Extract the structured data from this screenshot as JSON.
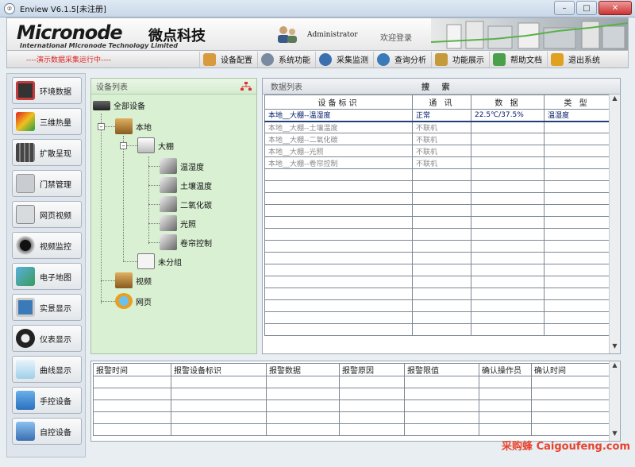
{
  "window": {
    "title": "Enview V6.1.5[未注册]",
    "icon_text": "②"
  },
  "header": {
    "logo": "Micronode",
    "logo_cn": "微点科技",
    "subtitle": "International Micronode Technology Limited",
    "username": "Administrator",
    "welcome": "欢迎登录"
  },
  "toolbar": {
    "running_text": "----演示数据采集运行中----",
    "items": [
      {
        "label": "设备配置",
        "icon": "device-config-icon",
        "color": "#d89a3a"
      },
      {
        "label": "系统功能",
        "icon": "gear-icon",
        "color": "#7a8aa0"
      },
      {
        "label": "采集监测",
        "icon": "search-icon",
        "color": "#3a6fb0"
      },
      {
        "label": "查询分析",
        "icon": "query-icon",
        "color": "#3a7ab8"
      },
      {
        "label": "功能展示",
        "icon": "display-icon",
        "color": "#c59a3a"
      },
      {
        "label": "帮助文档",
        "icon": "help-book-icon",
        "color": "#4aa04a"
      },
      {
        "label": "退出系统",
        "icon": "exit-icon",
        "color": "#e0a020"
      }
    ]
  },
  "sidebar": {
    "items": [
      {
        "label": "环境数据",
        "icon": "thermometer-icon",
        "color": "#c43c3c"
      },
      {
        "label": "三维热量",
        "icon": "heatmap-icon",
        "color": "#e05a20"
      },
      {
        "label": "扩散呈现",
        "icon": "diffusion-icon",
        "color": "#444444"
      },
      {
        "label": "门禁管理",
        "icon": "door-icon",
        "color": "#9aa0a6"
      },
      {
        "label": "网页视频",
        "icon": "camera-icon",
        "color": "#8a9098"
      },
      {
        "label": "视频监控",
        "icon": "cctv-icon",
        "color": "#333333"
      },
      {
        "label": "电子地图",
        "icon": "map-icon",
        "color": "#3a9a5a"
      },
      {
        "label": "实景显示",
        "icon": "monitor-icon",
        "color": "#3a7ab8"
      },
      {
        "label": "仪表显示",
        "icon": "gauge-icon",
        "color": "#222222"
      },
      {
        "label": "曲线显示",
        "icon": "chart-icon",
        "color": "#4aa0d0"
      },
      {
        "label": "手控设备",
        "icon": "hand-icon",
        "color": "#3a8ad0"
      },
      {
        "label": "自控设备",
        "icon": "auto-device-icon",
        "color": "#3a6fb0"
      }
    ]
  },
  "tree": {
    "title": "设备列表",
    "root": "全部设备",
    "local": "本地",
    "greenhouse": "大棚",
    "sensors": [
      "温湿度",
      "土壤温度",
      "二氧化碳",
      "光照",
      "卷帘控制"
    ],
    "ungrouped": "未分组",
    "video": "视频",
    "web": "网页"
  },
  "data_panel": {
    "title": "数据列表",
    "search": "搜 索",
    "columns": [
      "设备标识",
      "通 讯",
      "数 据",
      "类 型"
    ],
    "rows": [
      {
        "id": "本地__大棚--温湿度",
        "comm": "正常",
        "data": "22.5℃/37.5%",
        "type": "温湿度",
        "online": true
      },
      {
        "id": "本地__大棚--土壤温度",
        "comm": "不联机",
        "data": "",
        "type": "",
        "online": false
      },
      {
        "id": "本地__大棚--二氧化碳",
        "comm": "不联机",
        "data": "",
        "type": "",
        "online": false
      },
      {
        "id": "本地__大棚--光照",
        "comm": "不联机",
        "data": "",
        "type": "",
        "online": false
      },
      {
        "id": "本地__大棚--卷帘控制",
        "comm": "不联机",
        "data": "",
        "type": "",
        "online": false
      }
    ]
  },
  "alarm_panel": {
    "columns": [
      "报警时间",
      "报警设备标识",
      "报警数据",
      "报警原因",
      "报警限值",
      "确认操作员",
      "确认时间"
    ]
  },
  "watermark": "采购蜂 Caigoufeng.com"
}
